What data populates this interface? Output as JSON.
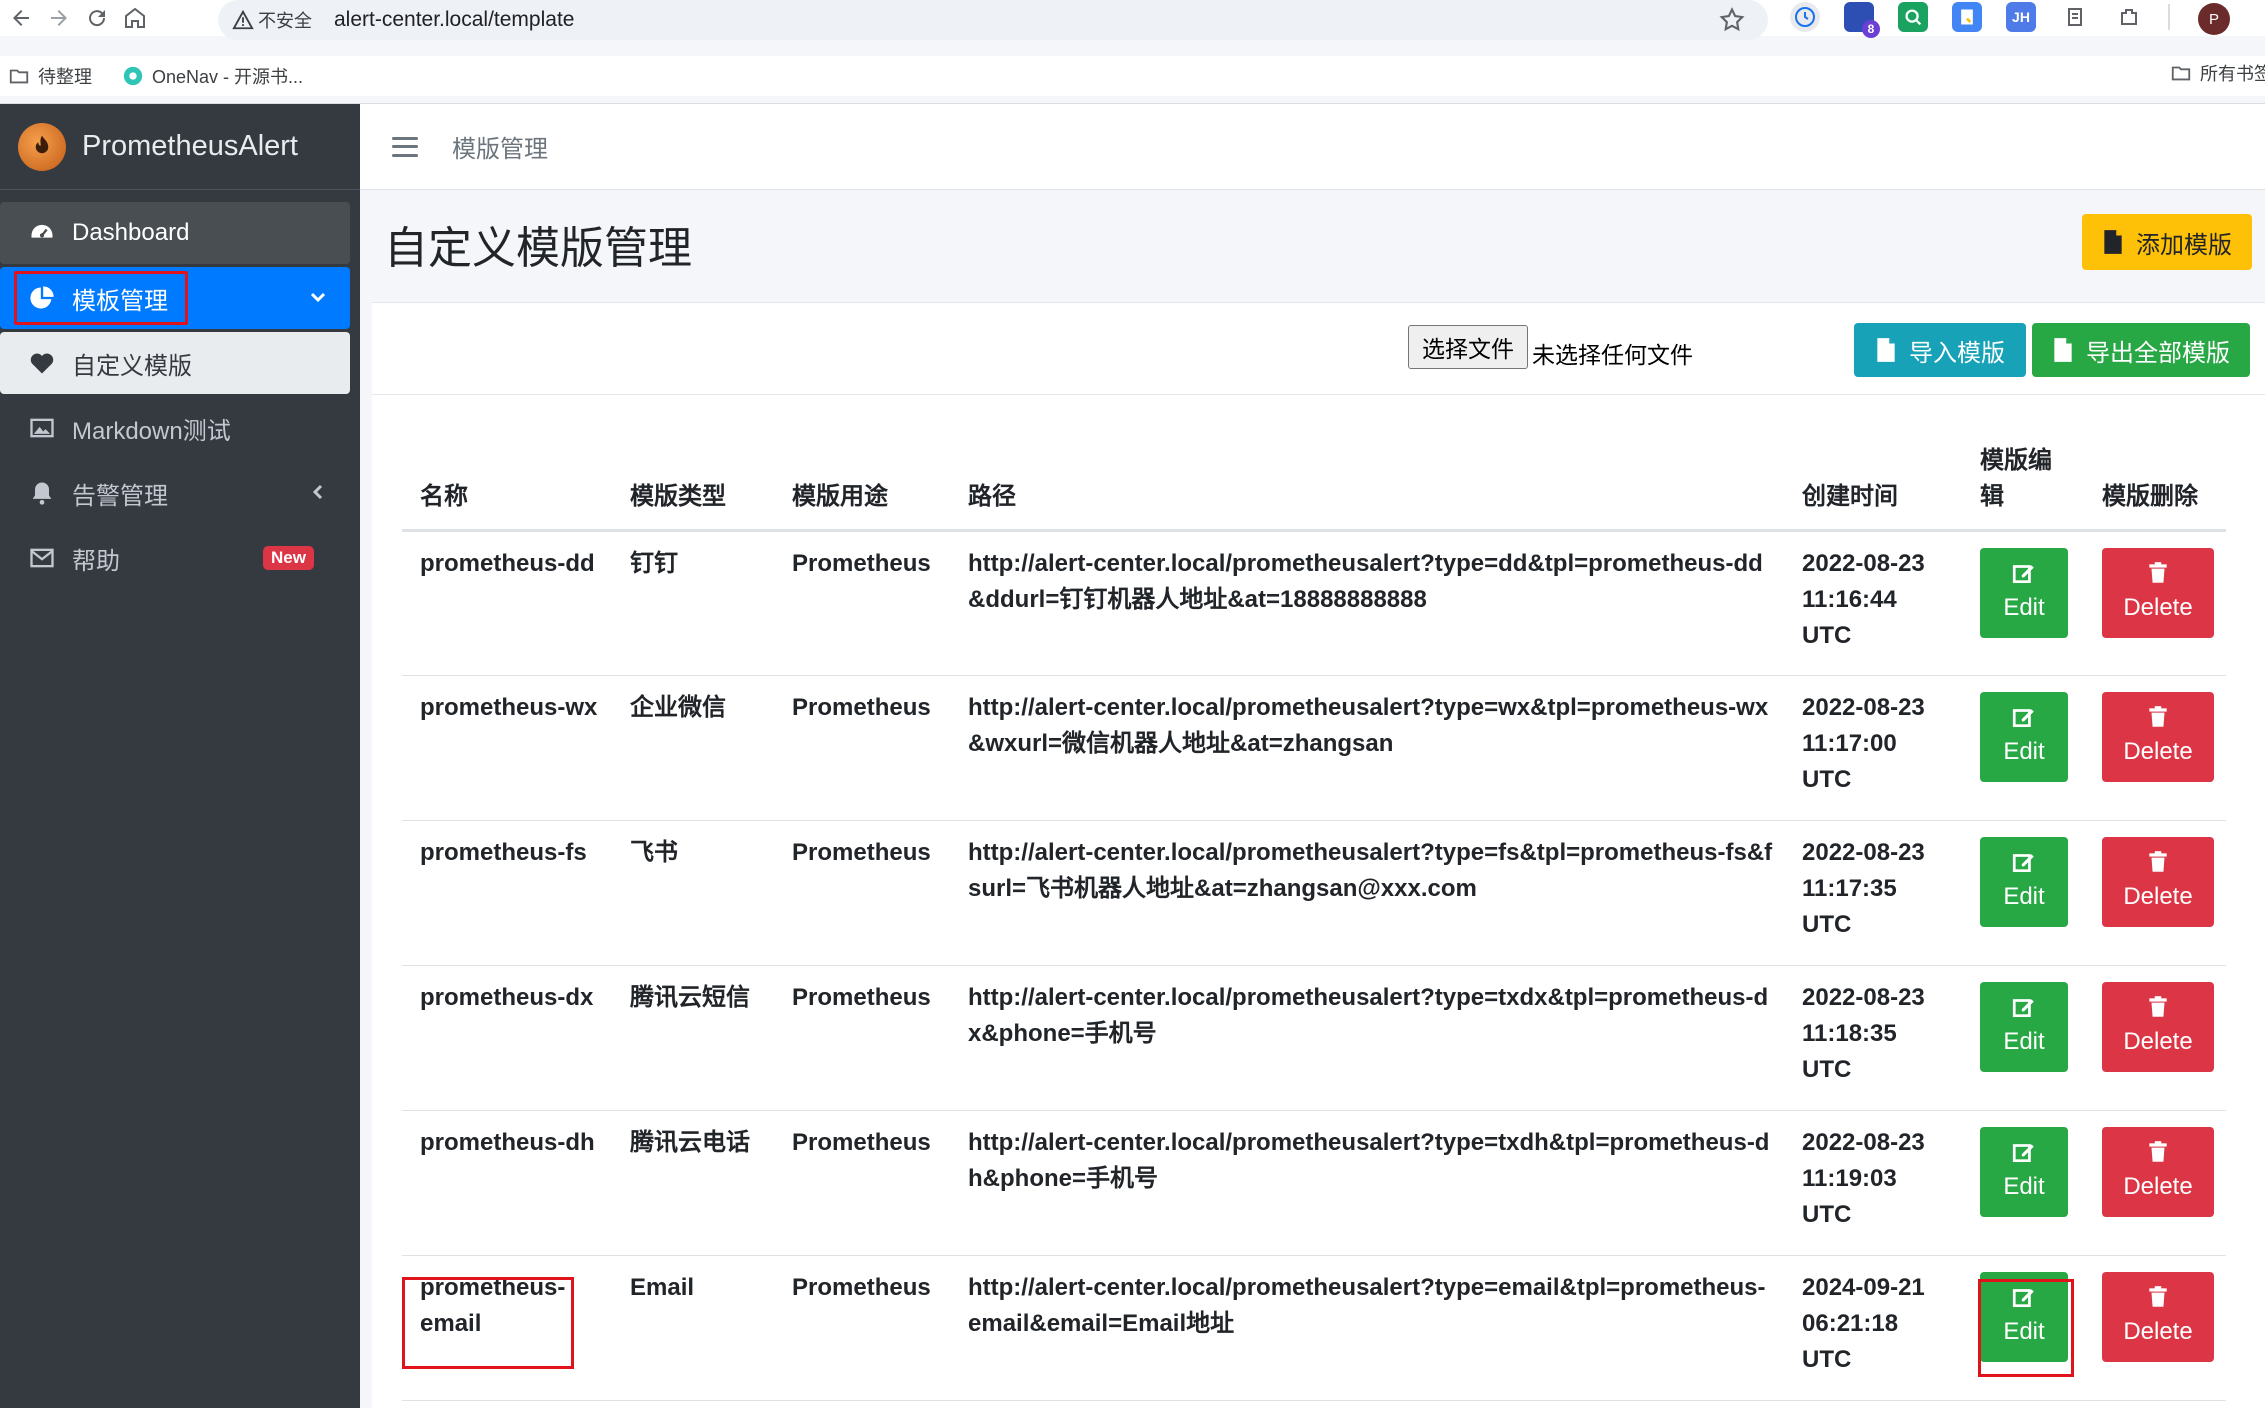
{
  "browser": {
    "security_label": "不安全",
    "url": "alert-center.local/template",
    "bookmarks": [
      "待整理",
      "OneNav - 开源书..."
    ],
    "bookmark_right": "所有书签",
    "profile_initial": "P",
    "ext_badge": "8",
    "ext_jh": "JH"
  },
  "sidebar": {
    "brand": "PrometheusAlert",
    "items": [
      {
        "label": "Dashboard",
        "icon": "dashboard-icon"
      },
      {
        "label": "模板管理",
        "icon": "pie-chart-icon"
      },
      {
        "label": "自定义模版",
        "icon": "heart-icon"
      },
      {
        "label": "Markdown测试",
        "icon": "image-icon"
      },
      {
        "label": "告警管理",
        "icon": "bell-icon"
      },
      {
        "label": "帮助",
        "icon": "envelope-icon",
        "badge": "New"
      }
    ]
  },
  "topnav": {
    "title": "模版管理"
  },
  "page": {
    "title": "自定义模版管理",
    "add_button": "添加模版",
    "file_button": "选择文件",
    "file_status": "未选择任何文件",
    "import_button": "导入模版",
    "export_button": "导出全部模版"
  },
  "table": {
    "headers": [
      "名称",
      "模版类型",
      "模版用途",
      "路径",
      "创建时间",
      "模版编辑",
      "模版删除"
    ],
    "edit_label": "Edit",
    "delete_label": "Delete",
    "rows": [
      {
        "name": "prometheus-dd",
        "type": "钉钉",
        "usage": "Prometheus",
        "path": "http://alert-center.local/prometheusalert?type=dd&tpl=prometheus-dd&ddurl=钉钉机器人地址&at=18888888888",
        "created": "2022-08-23 11:16:44 UTC"
      },
      {
        "name": "prometheus-wx",
        "type": "企业微信",
        "usage": "Prometheus",
        "path": "http://alert-center.local/prometheusalert?type=wx&tpl=prometheus-wx&wxurl=微信机器人地址&at=zhangsan",
        "created": "2022-08-23 11:17:00 UTC"
      },
      {
        "name": "prometheus-fs",
        "type": "飞书",
        "usage": "Prometheus",
        "path": "http://alert-center.local/prometheusalert?type=fs&tpl=prometheus-fs&fsurl=飞书机器人地址&at=zhangsan@xxx.com",
        "created": "2022-08-23 11:17:35 UTC"
      },
      {
        "name": "prometheus-dx",
        "type": "腾讯云短信",
        "usage": "Prometheus",
        "path": "http://alert-center.local/prometheusalert?type=txdx&tpl=prometheus-dx&phone=手机号",
        "created": "2022-08-23 11:18:35 UTC"
      },
      {
        "name": "prometheus-dh",
        "type": "腾讯云电话",
        "usage": "Prometheus",
        "path": "http://alert-center.local/prometheusalert?type=txdh&tpl=prometheus-dh&phone=手机号",
        "created": "2022-08-23 11:19:03 UTC"
      },
      {
        "name": "prometheus-email",
        "type": "Email",
        "usage": "Prometheus",
        "path": "http://alert-center.local/prometheusalert?type=email&tpl=prometheus-email&email=Email地址",
        "created": "2024-09-21 06:21:18 UTC"
      }
    ]
  },
  "colors": {
    "sidebar_bg": "#343a40",
    "active_blue": "#007bff",
    "success": "#28a745",
    "danger": "#dc3545",
    "warning": "#ffc107",
    "info": "#17a2b8",
    "highlight_red": "#e0121c"
  }
}
